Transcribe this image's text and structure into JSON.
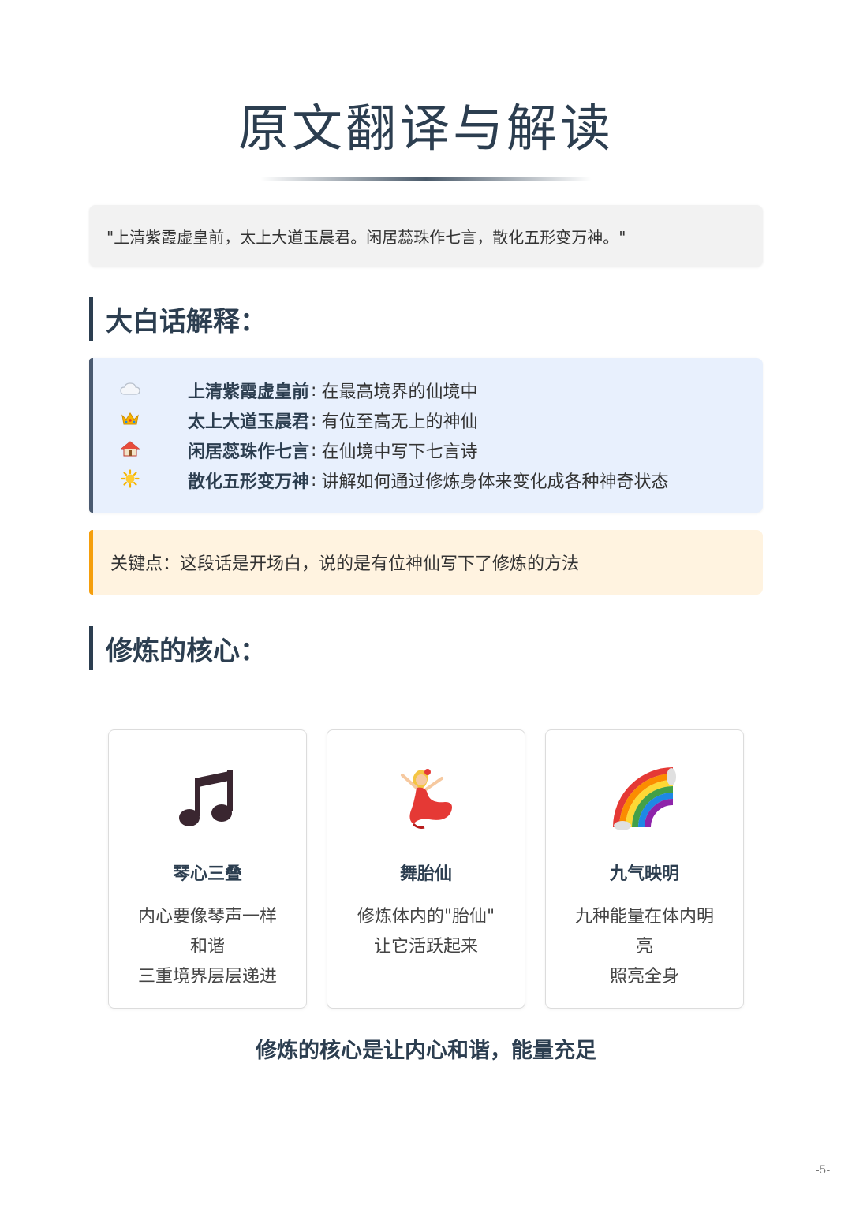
{
  "page_title": "原文翻译与解读",
  "quote": "\"上清紫霞虚皇前，太上大道玉晨君。闲居蕊珠作七言，散化五形变万神。\"",
  "explain_heading": "大白话解释：",
  "explain_items": [
    {
      "icon": "cloud-icon",
      "term": "上清紫霞虚皇前",
      "sep": ":",
      "desc": "在最高境界的仙境中"
    },
    {
      "icon": "crown-icon",
      "term": "太上大道玉晨君",
      "sep": ":",
      "desc": "有位至高无上的神仙"
    },
    {
      "icon": "house-icon",
      "term": "闲居蕊珠作七言",
      "sep": ":",
      "desc": "在仙境中写下七言诗"
    },
    {
      "icon": "sun-icon",
      "term": "散化五形变万神",
      "sep": ":",
      "desc": "讲解如何通过修炼身体来变化成各种神奇状态"
    }
  ],
  "key_point": "关键点：这段话是开场白，说的是有位神仙写下了修炼的方法",
  "core_heading": "修炼的核心：",
  "cards": [
    {
      "icon": "music-note-icon",
      "title": "琴心三叠",
      "lines": [
        "内心要像琴声一样",
        "和谐",
        "三重境界层层递进"
      ]
    },
    {
      "icon": "dancer-icon",
      "title": "舞胎仙",
      "lines": [
        "修炼体内的\"胎仙\"",
        "让它活跃起来",
        ""
      ]
    },
    {
      "icon": "rainbow-icon",
      "title": "九气映明",
      "lines": [
        "九种能量在体内明",
        "亮",
        "照亮全身"
      ]
    }
  ],
  "summary": "修炼的核心是让内心和谐，能量充足",
  "page_number": "-5-",
  "colors": {
    "heading": "#2c3e50",
    "explain_bg": "#e8f0fd",
    "key_bg": "#fff3e0",
    "key_accent": "#f59e0b"
  }
}
